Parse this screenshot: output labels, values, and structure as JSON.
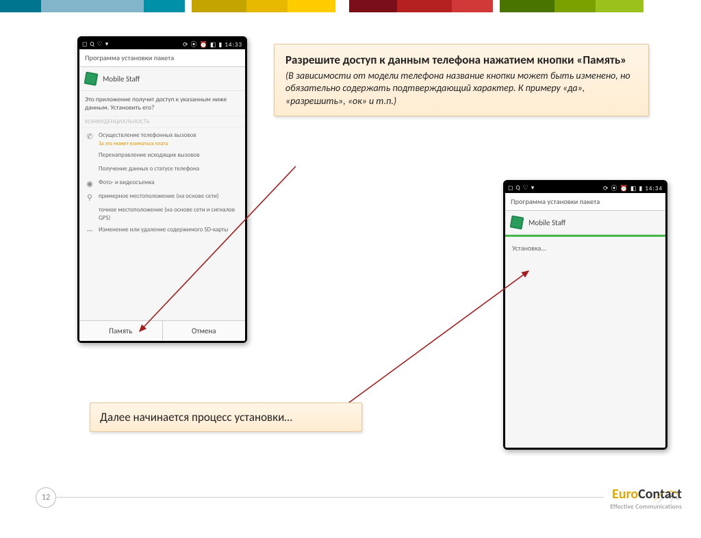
{
  "stripes": [
    "#00758f",
    "#82b5c9",
    "#82b5c9",
    "#0090a8",
    "#fff",
    "#c4a500",
    "#e6b800",
    "#ffcc00",
    "#fff",
    "#fff",
    "#7a0f1a",
    "#b52121",
    "#d13838",
    "#fff",
    "#4a7400",
    "#7ba100",
    "#9bc21c"
  ],
  "phoneA": {
    "status_left": "◻ Q ♡ ▾",
    "status_right": "⟳ ⦿ ⏰ ◧ ▮ 14:33",
    "title": "Программа установки пакета",
    "app_name": "Mobile Staff",
    "desc": "Это приложение получит доступ к указанным ниже данным. Установить его?",
    "section": "КОНФИДЕНЦИАЛЬНОСТЬ",
    "perms": [
      {
        "icon": "phone",
        "text": "Осуществление телефонных вызовов",
        "warn": "За это может взиматься плата"
      },
      {
        "icon": "",
        "text": "Перенаправление исходящих вызовов"
      },
      {
        "icon": "",
        "text": "Получение данных о статусе телефона"
      },
      {
        "icon": "camera",
        "text": "Фото- и видеосъемка"
      },
      {
        "icon": "pin",
        "text": "примерное местоположение (на основе сети)"
      },
      {
        "icon": "",
        "text": "точное местоположение (на основе сети и сигналов GPS)"
      },
      {
        "icon": "usb",
        "text": "Изменение или удаление содержимого SD-карты"
      }
    ],
    "btn_ok": "Память",
    "btn_cancel": "Отмена"
  },
  "phoneB": {
    "status_left": "◻ Q ♡ ▾",
    "status_right": "⟳ ⦿ ⏰ ◧ ▮ 14:34",
    "title": "Программа установки пакета",
    "app_name": "Mobile Staff",
    "body": "Установка..."
  },
  "callout1": {
    "head": "Разрешите доступ к данным телефона нажатием кнопки «Память»",
    "sub": "(В зависимости от модели телефона название кнопки может быть изменено, но обязательно содержать подтверждающий характер. К примеру «да», «разрешить», «ок» и т.п.)"
  },
  "callout2": "Далее начинается процесс установки…",
  "logo": {
    "brand_a": "Euro",
    "brand_b": "Contact",
    "tag": "Effective Communications"
  },
  "page": "12",
  "corner": "7"
}
